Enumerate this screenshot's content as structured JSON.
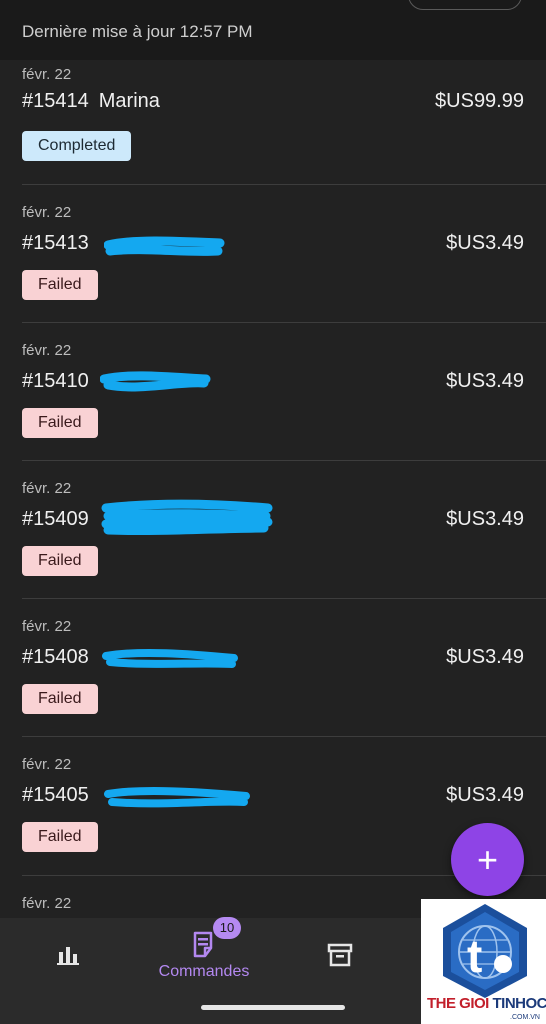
{
  "header": {
    "last_update": "Dernière mise à jour 12:57 PM"
  },
  "orders": [
    {
      "date": "févr. 22",
      "number": "#15414",
      "name": "Marina",
      "amount": "$US99.99",
      "status": "Completed"
    },
    {
      "date": "févr. 22",
      "number": "#15413",
      "name": "",
      "amount": "$US3.49",
      "status": "Failed"
    },
    {
      "date": "févr. 22",
      "number": "#15410",
      "name": "",
      "amount": "$US3.49",
      "status": "Failed"
    },
    {
      "date": "févr. 22",
      "number": "#15409",
      "name": "",
      "amount": "$US3.49",
      "status": "Failed"
    },
    {
      "date": "févr. 22",
      "number": "#15408",
      "name": "",
      "amount": "$US3.49",
      "status": "Failed"
    },
    {
      "date": "févr. 22",
      "number": "#15405",
      "name": "",
      "amount": "$US3.49",
      "status": "Failed"
    },
    {
      "date": "févr. 22"
    }
  ],
  "fab": {
    "icon": "plus-icon",
    "label": "+"
  },
  "nav": {
    "items": [
      {
        "icon": "bar-chart-icon",
        "label": ""
      },
      {
        "icon": "orders-document-icon",
        "label": "Commandes",
        "badge": "10",
        "active": true
      },
      {
        "icon": "archive-box-icon",
        "label": ""
      }
    ]
  },
  "watermark": {
    "brand_part1": "THE GIOI",
    "brand_part2": "TINHOC",
    "suffix": ".COM.VN"
  },
  "colors": {
    "accent": "#8e44e6",
    "completed_badge": "#cde9fb",
    "failed_badge": "#f9d2d4",
    "scribble": "#14a8f0"
  }
}
